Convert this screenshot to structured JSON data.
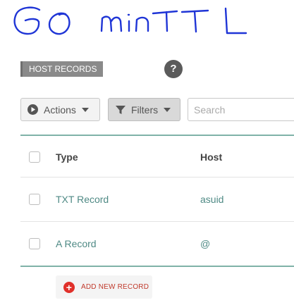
{
  "annotation": {
    "text": "60 min TTL",
    "color": "#1f35d6"
  },
  "section": {
    "label": "HOST RECORDS",
    "help_label": "?"
  },
  "toolbar": {
    "actions_label": "Actions",
    "filters_label": "Filters",
    "search_placeholder": "Search",
    "icons": {
      "actions": "play-circle-icon",
      "filters": "filter-funnel-icon",
      "dropdown": "caret-down-icon"
    }
  },
  "table": {
    "headers": {
      "type": "Type",
      "host": "Host"
    },
    "rows": [
      {
        "type": "TXT Record",
        "host": "asuid"
      },
      {
        "type": "A Record",
        "host": "@"
      }
    ]
  },
  "add_record": {
    "label": "ADD NEW RECORD",
    "icon": "plus-circle-icon"
  },
  "colors": {
    "accent": "#4f8a85",
    "rule": "#7fb2a8",
    "danger": "#e0302a",
    "section_bg": "#8a8a8a"
  }
}
